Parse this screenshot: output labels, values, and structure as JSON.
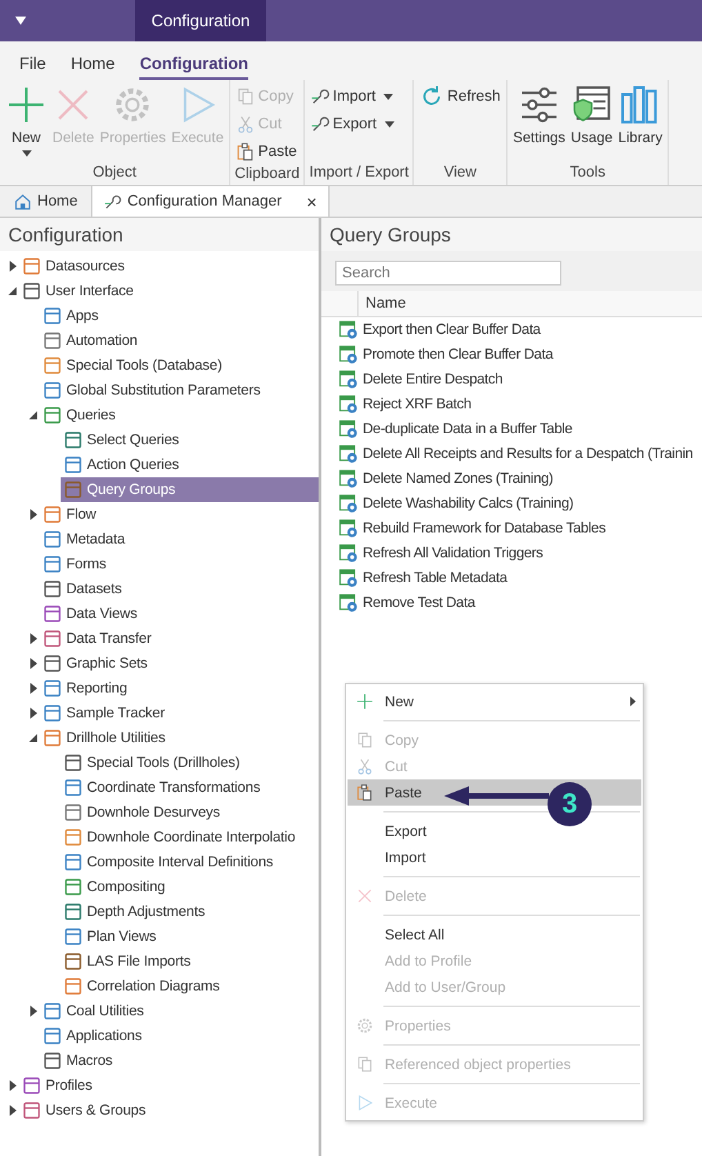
{
  "title_bar": {
    "context_tab": "Configuration"
  },
  "menu_tabs": [
    {
      "label": "File",
      "selected": false
    },
    {
      "label": "Home",
      "selected": false
    },
    {
      "label": "Configuration",
      "selected": true
    }
  ],
  "ribbon_groups": [
    {
      "label": "Object",
      "kind": "large",
      "buttons": [
        {
          "label": "New",
          "disabled": false,
          "dropdown": true
        },
        {
          "label": "Delete",
          "disabled": true,
          "dropdown": false
        },
        {
          "label": "Properties",
          "disabled": true,
          "dropdown": false
        },
        {
          "label": "Execute",
          "disabled": true,
          "dropdown": false
        }
      ]
    },
    {
      "label": "Clipboard",
      "kind": "small",
      "buttons": [
        {
          "label": "Copy",
          "disabled": true,
          "dropdown": false
        },
        {
          "label": "Cut",
          "disabled": true,
          "dropdown": false
        },
        {
          "label": "Paste",
          "disabled": false,
          "dropdown": false
        }
      ]
    },
    {
      "label": "Import / Export",
      "kind": "small",
      "buttons": [
        {
          "label": "Import",
          "disabled": false,
          "dropdown": true
        },
        {
          "label": "Export",
          "disabled": false,
          "dropdown": true
        }
      ]
    },
    {
      "label": "View",
      "kind": "small",
      "buttons": [
        {
          "label": "Refresh",
          "disabled": false,
          "dropdown": false
        }
      ]
    },
    {
      "label": "Tools",
      "kind": "large",
      "buttons": [
        {
          "label": "Settings",
          "disabled": false,
          "dropdown": false
        },
        {
          "label": "Usage",
          "disabled": false,
          "dropdown": false
        },
        {
          "label": "Library",
          "disabled": false,
          "dropdown": false
        }
      ]
    }
  ],
  "doc_tabs": [
    {
      "label": "Home",
      "selected": false
    },
    {
      "label": "Configuration Manager",
      "selected": true,
      "close": "×"
    }
  ],
  "left_panel": {
    "title": "Configuration",
    "tree": [
      {
        "label": "Datasources",
        "kind": "branch",
        "expanded": false,
        "selected": false
      },
      {
        "label": "User Interface",
        "kind": "branch",
        "expanded": true,
        "selected": false,
        "children": [
          {
            "label": "Apps",
            "kind": "leaf",
            "selected": false
          },
          {
            "label": "Automation",
            "kind": "leaf",
            "selected": false
          },
          {
            "label": "Special Tools (Database)",
            "kind": "leaf",
            "selected": false
          },
          {
            "label": "Global Substitution Parameters",
            "kind": "leaf",
            "selected": false
          },
          {
            "label": "Queries",
            "kind": "branch",
            "expanded": true,
            "selected": false,
            "children": [
              {
                "label": "Select Queries",
                "kind": "leaf",
                "selected": false
              },
              {
                "label": "Action Queries",
                "kind": "leaf",
                "selected": false
              },
              {
                "label": "Query Groups",
                "kind": "leaf",
                "selected": true
              }
            ]
          },
          {
            "label": "Flow",
            "kind": "branch",
            "expanded": false,
            "selected": false
          },
          {
            "label": "Metadata",
            "kind": "leaf",
            "selected": false
          },
          {
            "label": "Forms",
            "kind": "leaf",
            "selected": false
          },
          {
            "label": "Datasets",
            "kind": "leaf",
            "selected": false
          },
          {
            "label": "Data Views",
            "kind": "leaf",
            "selected": false
          },
          {
            "label": "Data Transfer",
            "kind": "branch",
            "expanded": false,
            "selected": false
          },
          {
            "label": "Graphic Sets",
            "kind": "branch",
            "expanded": false,
            "selected": false
          },
          {
            "label": "Reporting",
            "kind": "branch",
            "expanded": false,
            "selected": false
          },
          {
            "label": "Sample Tracker",
            "kind": "branch",
            "expanded": false,
            "selected": false
          },
          {
            "label": "Drillhole Utilities",
            "kind": "branch",
            "expanded": true,
            "selected": false,
            "children": [
              {
                "label": "Special Tools (Drillholes)",
                "kind": "leaf",
                "selected": false
              },
              {
                "label": "Coordinate Transformations",
                "kind": "leaf",
                "selected": false
              },
              {
                "label": "Downhole Desurveys",
                "kind": "leaf",
                "selected": false
              },
              {
                "label": "Downhole Coordinate Interpolatio",
                "kind": "leaf",
                "selected": false
              },
              {
                "label": "Composite Interval Definitions",
                "kind": "leaf",
                "selected": false
              },
              {
                "label": "Compositing",
                "kind": "leaf",
                "selected": false
              },
              {
                "label": "Depth Adjustments",
                "kind": "leaf",
                "selected": false
              },
              {
                "label": "Plan Views",
                "kind": "leaf",
                "selected": false
              },
              {
                "label": "LAS File Imports",
                "kind": "leaf",
                "selected": false
              },
              {
                "label": "Correlation Diagrams",
                "kind": "leaf",
                "selected": false
              }
            ]
          },
          {
            "label": "Coal Utilities",
            "kind": "branch",
            "expanded": false,
            "selected": false
          },
          {
            "label": "Applications",
            "kind": "leaf",
            "selected": false
          },
          {
            "label": "Macros",
            "kind": "leaf",
            "selected": false
          }
        ]
      },
      {
        "label": "Profiles",
        "kind": "branch",
        "expanded": false,
        "selected": false
      },
      {
        "label": "Users & Groups",
        "kind": "branch",
        "expanded": false,
        "selected": false
      }
    ]
  },
  "right_panel": {
    "title": "Query Groups",
    "search": {
      "placeholder": "Search"
    },
    "table": {
      "columns": [
        "Name"
      ],
      "rows": [
        "Export then Clear Buffer Data",
        "Promote then Clear Buffer Data",
        "Delete Entire Despatch",
        "Reject XRF Batch",
        "De-duplicate Data in a Buffer Table",
        "Delete All Receipts and Results for a Despatch (Trainin",
        "Delete Named Zones (Training)",
        "Delete Washability Calcs (Training)",
        "Rebuild Framework for Database Tables",
        "Refresh All Validation Triggers",
        "Refresh Table Metadata",
        "Remove Test Data"
      ]
    }
  },
  "context_menu": {
    "sections": [
      [
        {
          "label": "New",
          "disabled": false,
          "selected": false,
          "submenu": true
        }
      ],
      [
        {
          "label": "Copy",
          "disabled": true,
          "selected": false,
          "submenu": false
        },
        {
          "label": "Cut",
          "disabled": true,
          "selected": false,
          "submenu": false
        },
        {
          "label": "Paste",
          "disabled": false,
          "selected": true,
          "submenu": false
        }
      ],
      [
        {
          "label": "Export",
          "disabled": false,
          "selected": false,
          "submenu": false
        },
        {
          "label": "Import",
          "disabled": false,
          "selected": false,
          "submenu": false
        }
      ],
      [
        {
          "label": "Delete",
          "disabled": true,
          "selected": false,
          "submenu": false
        }
      ],
      [
        {
          "label": "Select All",
          "disabled": false,
          "selected": false,
          "submenu": false
        },
        {
          "label": "Add to Profile",
          "disabled": true,
          "selected": false,
          "submenu": false
        },
        {
          "label": "Add to User/Group",
          "disabled": true,
          "selected": false,
          "submenu": false
        }
      ],
      [
        {
          "label": "Properties",
          "disabled": true,
          "selected": false,
          "submenu": false
        }
      ],
      [
        {
          "label": "Referenced object properties",
          "disabled": true,
          "selected": false,
          "submenu": false
        }
      ],
      [
        {
          "label": "Execute",
          "disabled": true,
          "selected": false,
          "submenu": false
        }
      ]
    ]
  },
  "callout": {
    "label": "3"
  }
}
